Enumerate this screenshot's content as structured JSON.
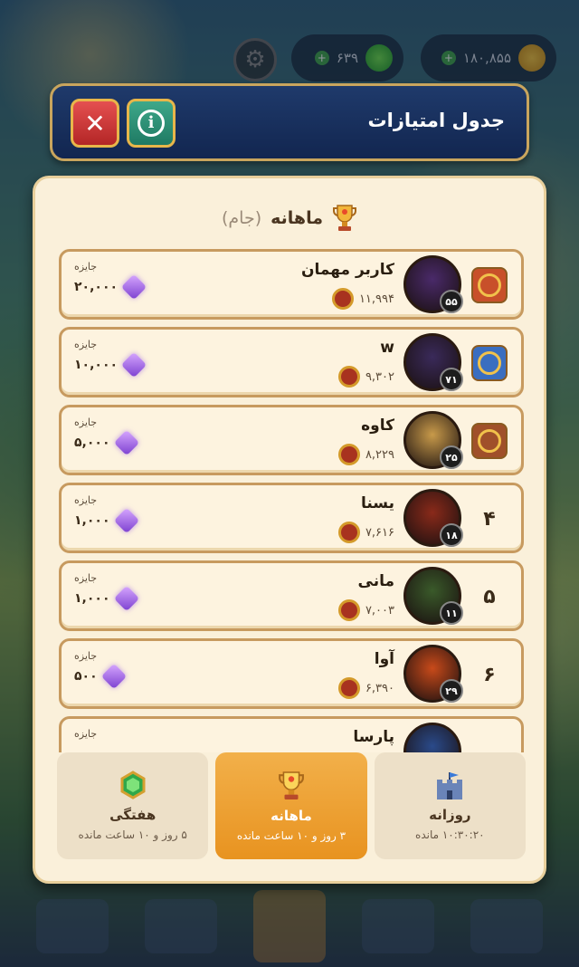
{
  "hud": {
    "gems": "۶۳۹",
    "gold": "۱۸۰,۸۵۵"
  },
  "header": {
    "title": "جدول امتیازات"
  },
  "panel": {
    "period": "ماهانه",
    "period_type": "(جام)"
  },
  "rows": [
    {
      "rank": "",
      "name": "کاربر مهمان",
      "score": "۱۱,۹۹۴",
      "level": "۵۵",
      "prize_label": "جایزه",
      "prize": "۲۰,۰۰۰",
      "badge_color": "#c8502a"
    },
    {
      "rank": "",
      "name": "w",
      "score": "۹,۳۰۲",
      "level": "۷۱",
      "prize_label": "جایزه",
      "prize": "۱۰,۰۰۰",
      "badge_color": "#3a6ec0"
    },
    {
      "rank": "",
      "name": "کاوه",
      "score": "۸,۲۲۹",
      "level": "۲۵",
      "prize_label": "جایزه",
      "prize": "۵,۰۰۰",
      "badge_color": "#a0502a"
    },
    {
      "rank": "۴",
      "name": "یسنا",
      "score": "۷,۶۱۶",
      "level": "۱۸",
      "prize_label": "جایزه",
      "prize": "۱,۰۰۰"
    },
    {
      "rank": "۵",
      "name": "مانی",
      "score": "۷,۰۰۳",
      "level": "۱۱",
      "prize_label": "جایزه",
      "prize": "۱,۰۰۰"
    },
    {
      "rank": "۶",
      "name": "آوا",
      "score": "۶,۳۹۰",
      "level": "۲۹",
      "prize_label": "جایزه",
      "prize": "۵۰۰"
    },
    {
      "rank": "",
      "name": "پارسا",
      "score": "",
      "level": "",
      "prize_label": "جایزه",
      "prize": ""
    }
  ],
  "tabs": [
    {
      "label": "روزانه",
      "sub": "۱۰:۳۰:۲۰ مانده"
    },
    {
      "label": "ماهانه",
      "sub": "۳ روز و ۱۰ ساعت مانده"
    },
    {
      "label": "هفتگی",
      "sub": "۵ روز و ۱۰ ساعت مانده"
    }
  ],
  "colors": {
    "accent": "#e89320",
    "panel": "#faf0da",
    "header": "#1f3a6b"
  }
}
